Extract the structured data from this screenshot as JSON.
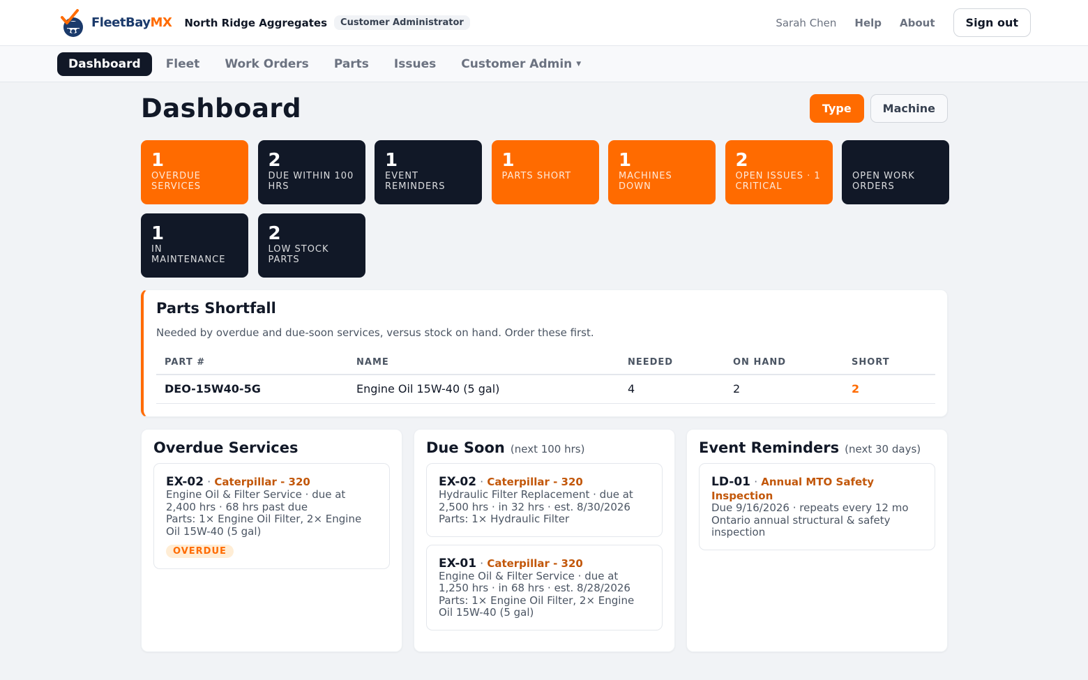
{
  "brand": {
    "name": "FleetBay",
    "suffix": "MX"
  },
  "org": {
    "name": "North Ridge Aggregates",
    "role": "Customer Administrator"
  },
  "user": {
    "name": "Sarah Chen",
    "help": "Help",
    "about": "About",
    "signout": "Sign out"
  },
  "nav": [
    {
      "label": "Dashboard",
      "active": true
    },
    {
      "label": "Fleet"
    },
    {
      "label": "Work Orders"
    },
    {
      "label": "Parts"
    },
    {
      "label": "Issues"
    },
    {
      "label": "Customer Admin"
    }
  ],
  "page": {
    "title": "Dashboard",
    "toggle": [
      "Type",
      "Machine"
    ]
  },
  "stats": [
    {
      "value": "1",
      "label": "OVERDUE SERVICES",
      "color": "orange"
    },
    {
      "value": "2",
      "label": "DUE WITHIN 100 HRS",
      "color": "dark"
    },
    {
      "value": "1",
      "label": "EVENT REMINDERS",
      "color": "dark"
    },
    {
      "value": "1",
      "label": "PARTS SHORT",
      "color": "orange"
    },
    {
      "value": "1",
      "label": "MACHINES DOWN",
      "color": "orange"
    },
    {
      "value": "2",
      "label": "OPEN ISSUES · 1 CRITICAL",
      "color": "orange"
    },
    {
      "value": "",
      "label": "OPEN WORK ORDERS",
      "color": "dark"
    },
    {
      "value": "1",
      "label": "IN MAINTENANCE",
      "color": "dark"
    },
    {
      "value": "2",
      "label": "LOW STOCK PARTS",
      "color": "dark"
    }
  ],
  "shortfall": {
    "title": "Parts Shortfall",
    "subtitle": "Needed by overdue and due-soon services, versus stock on hand. Order these first.",
    "columns": [
      "PART #",
      "NAME",
      "NEEDED",
      "ON HAND",
      "SHORT"
    ],
    "rows": [
      {
        "part": "DEO-15W40-5G",
        "name": "Engine Oil 15W-40 (5 gal)",
        "needed": "4",
        "on_hand": "2",
        "short": "2"
      }
    ]
  },
  "overdue": {
    "title": "Overdue Services",
    "items": [
      {
        "id": "EX-02",
        "machine": "Caterpillar - 320",
        "line1": "Engine Oil & Filter Service · due at 2,400 hrs · 68 hrs past due",
        "line2": "Parts: 1× Engine Oil Filter, 2× Engine Oil 15W-40 (5 gal)",
        "badge": "OVERDUE"
      }
    ]
  },
  "due_soon": {
    "title": "Due Soon",
    "note": "(next 100 hrs)",
    "items": [
      {
        "id": "EX-02",
        "machine": "Caterpillar - 320",
        "line1": "Hydraulic Filter Replacement · due at 2,500 hrs · in 32 hrs · est. 8/30/2026",
        "line2": "Parts: 1× Hydraulic Filter"
      },
      {
        "id": "EX-01",
        "machine": "Caterpillar - 320",
        "line1": "Engine Oil & Filter Service · due at 1,250 hrs · in 68 hrs · est. 8/28/2026",
        "line2": "Parts: 1× Engine Oil Filter, 2× Engine Oil 15W-40 (5 gal)"
      }
    ]
  },
  "events": {
    "title": "Event Reminders",
    "note": "(next 30 days)",
    "items": [
      {
        "id": "LD-01",
        "machine": "Annual MTO Safety Inspection",
        "line1": "Due 9/16/2026 · repeats every 12 mo",
        "line2": "Ontario annual structural & safety inspection"
      }
    ]
  },
  "colors": {
    "accent": "#ff6b00",
    "dark": "#111827",
    "brand_blue": "#1b3a6b"
  }
}
